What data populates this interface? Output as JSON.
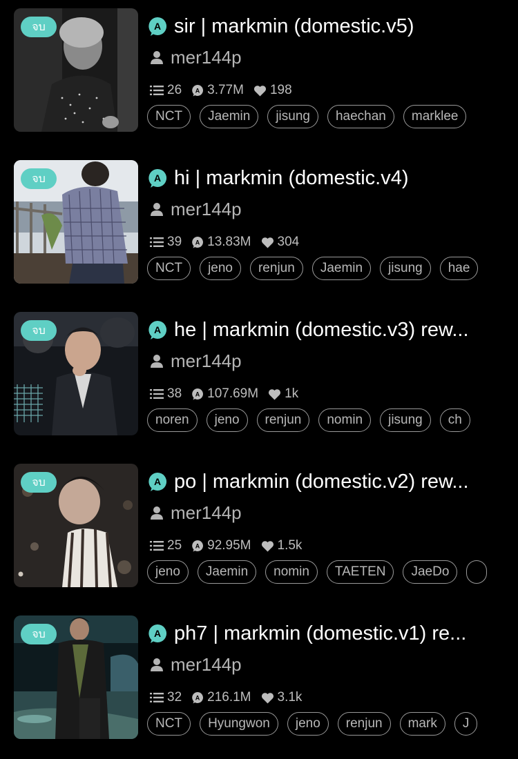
{
  "colors": {
    "background": "#000000",
    "badge": "#5fcfc4",
    "accent": "#5fcfc4",
    "title": "#ffffff",
    "muted": "#b5b5b5"
  },
  "icons": {
    "chapters": "list-icon",
    "reads": "a-bubble-icon",
    "likes": "heart-icon",
    "author": "person-icon",
    "story_type": "a-bubble-icon"
  },
  "stories": [
    {
      "badge": "จบ",
      "title": "sir | markmin (domestic.v5)",
      "author": "mer144p",
      "chapters": "26",
      "reads": "3.77M",
      "likes": "198",
      "tags": [
        "NCT",
        "Jaemin",
        "jisung",
        "haechan",
        "marklee"
      ]
    },
    {
      "badge": "จบ",
      "title": "hi | markmin (domestic.v4)",
      "author": "mer144p",
      "chapters": "39",
      "reads": "13.83M",
      "likes": "304",
      "tags": [
        "NCT",
        "jeno",
        "renjun",
        "Jaemin",
        "jisung",
        "hae"
      ]
    },
    {
      "badge": "จบ",
      "title": "he | markmin (domestic.v3) rew...",
      "author": "mer144p",
      "chapters": "38",
      "reads": "107.69M",
      "likes": "1k",
      "tags": [
        "noren",
        "jeno",
        "renjun",
        "nomin",
        "jisung",
        "ch"
      ]
    },
    {
      "badge": "จบ",
      "title": "po | markmin (domestic.v2) rew...",
      "author": "mer144p",
      "chapters": "25",
      "reads": "92.95M",
      "likes": "1.5k",
      "tags": [
        "jeno",
        "Jaemin",
        "nomin",
        "TAETEN",
        "JaeDo",
        ""
      ]
    },
    {
      "badge": "จบ",
      "title": "ph7 | markmin (domestic.v1) re...",
      "author": "mer144p",
      "chapters": "32",
      "reads": "216.1M",
      "likes": "3.1k",
      "tags": [
        "NCT",
        "Hyungwon",
        "jeno",
        "renjun",
        "mark",
        "J"
      ]
    }
  ]
}
